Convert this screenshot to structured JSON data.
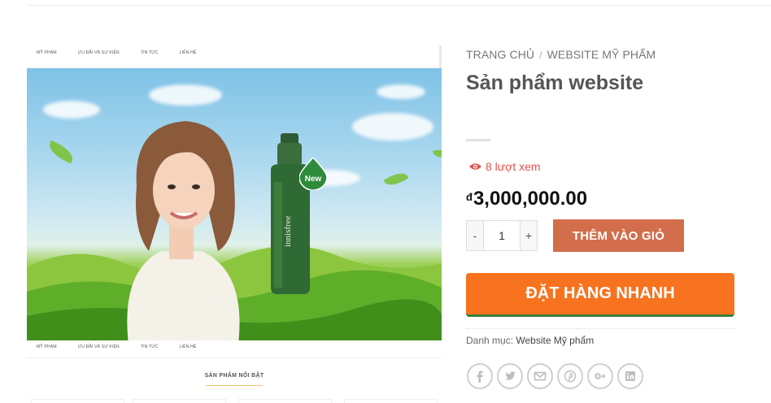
{
  "product_image": {
    "nav_items": [
      "MỸ PHẨM",
      "ƯU ĐÃI VÀ SỰ KIỆN",
      "TIN TỨC",
      "LIÊN HỆ"
    ],
    "badge_text": "New",
    "bottle_brand": "innisfree",
    "featured_title": "SẢN PHẨM NỔI BẬT"
  },
  "breadcrumb": {
    "home": "TRANG CHỦ",
    "separator": "/",
    "category": "WEBSITE MỸ PHẨM"
  },
  "product": {
    "title": "Sản phẩm website",
    "views": "8 lượt xem",
    "currency_symbol": "đ",
    "price": "3,000,000.00",
    "quantity": "1",
    "minus_label": "-",
    "plus_label": "+",
    "add_to_cart_label": "THÊM VÀO GIỎ",
    "quick_order_label": "ĐẶT HÀNG NHANH",
    "category_label": "Danh mục:",
    "category_value": "Website Mỹ phẩm"
  },
  "share_icons": [
    "facebook-icon",
    "twitter-icon",
    "email-icon",
    "pinterest-icon",
    "google-plus-icon",
    "linkedin-icon"
  ],
  "colors": {
    "add_to_cart": "#d26e4b",
    "quick_order": "#f7731f",
    "views_text": "#e2524d"
  }
}
